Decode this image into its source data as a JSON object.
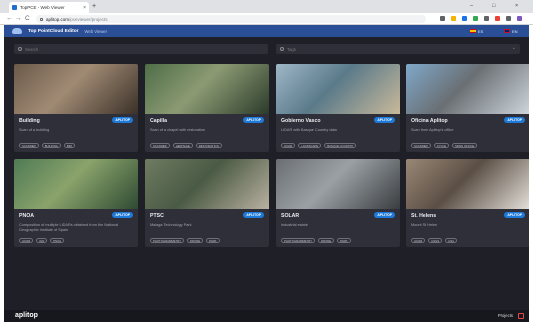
{
  "browser": {
    "tab_title": "TopPCE - Web Viewer",
    "tab_close": "×",
    "new_tab": "+",
    "url_host": "aplitop.com",
    "url_path": "/pceviewer/projects",
    "win_min": "–",
    "win_max": "□",
    "win_close": "×",
    "nav_back": "←",
    "nav_forward": "→",
    "nav_reload": "C",
    "extension_colors": [
      "#5f6368",
      "#f4b400",
      "#1a73e8",
      "#34a853",
      "#5f6368",
      "#ea4335",
      "#5f6368",
      "#7e57c2"
    ]
  },
  "appbar": {
    "title": "Top PointCloud Editor",
    "subtitle": "Web Viewer",
    "lang_es": "ES",
    "lang_en": "EN"
  },
  "search": {
    "left_placeholder": "Search",
    "right_placeholder": "Tags"
  },
  "projects": [
    {
      "title": "Building",
      "badge": "APLITOP",
      "desc": "Scan of a building",
      "tags": [
        "SCANNER",
        "BUILDING",
        "BIM"
      ],
      "colors": [
        "#6b5a4a",
        "#3b3128",
        "#a08a74"
      ]
    },
    {
      "title": "Capilla",
      "badge": "APLITOP",
      "desc": "Scan of a chapel with restoration",
      "tags": [
        "SCANNER",
        "HERITAGE",
        "RESTORATION"
      ],
      "colors": [
        "#4e6e48",
        "#2c3b2a",
        "#8c9a73"
      ]
    },
    {
      "title": "Gobierno Vasco",
      "badge": "APLITOP",
      "desc": "LIDAR with Basque Country data",
      "tags": [
        "LIDAR",
        "LANDSCAPE",
        "BASQUE COUNTRY"
      ],
      "colors": [
        "#9fb7c7",
        "#c9b99a",
        "#5a7a8a"
      ]
    },
    {
      "title": "Oficina Aplitop",
      "badge": "APLITOP",
      "desc": "Scan from Aplitop's office",
      "tags": [
        "SCANNER",
        "CYCLE",
        "SPAIN OFFICE"
      ],
      "colors": [
        "#7fa8c9",
        "#cfd7dc",
        "#6a6f74"
      ]
    },
    {
      "title": "PNOA",
      "badge": "APLITOP",
      "desc": "Composition of multiple LIDARs obtained from the National Geographic Institute of Spain",
      "tags": [
        "LIDAR",
        "IGN",
        "PNOA"
      ],
      "colors": [
        "#4f7a55",
        "#2f4a33",
        "#8aa36b"
      ]
    },
    {
      "title": "PTSC",
      "badge": "APLITOP",
      "desc": "Malaga Technology Park",
      "tags": [
        "PHOTOGRAMMETRY",
        "DRONE",
        "PARK"
      ],
      "colors": [
        "#6f7b62",
        "#b9b0a0",
        "#4a5a44"
      ]
    },
    {
      "title": "SOLAR",
      "badge": "APLITOP",
      "desc": "Industrial estate",
      "tags": [
        "PHOTOGRAMMETRY",
        "DRONE",
        "PARK"
      ],
      "colors": [
        "#6b6f73",
        "#3a3d40",
        "#9aa0a4"
      ]
    },
    {
      "title": "St. Helens",
      "badge": "APLITOP",
      "desc": "Mount St Helen",
      "tags": [
        "LIDAR",
        "USGS",
        "USA"
      ],
      "colors": [
        "#9a8876",
        "#e4e0da",
        "#5b4f45"
      ]
    }
  ],
  "footer": {
    "logo": "aplitop",
    "link": "Projects"
  }
}
